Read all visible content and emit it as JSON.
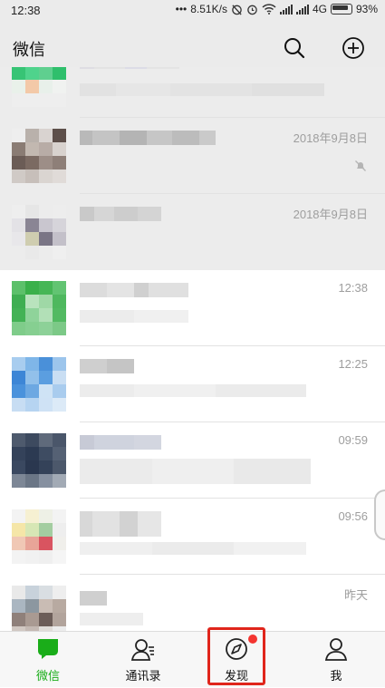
{
  "statusbar": {
    "time": "12:38",
    "dots": "•••",
    "net_speed": "8.51K/s",
    "network_type": "4G",
    "battery": "93%",
    "icons": [
      "alarm-off-icon",
      "alarm-icon",
      "wifi-icon",
      "signal-icon",
      "battery-icon"
    ]
  },
  "header": {
    "title": "微信",
    "search_icon": "search-icon",
    "add_icon": "plus-circle-icon"
  },
  "chats": [
    {
      "time": "",
      "pinned": true,
      "muted": false,
      "avatar_colors": [
        "#e9f2ec",
        "#dfeee4",
        "#e8f3ec",
        "#eef5f0",
        "#37c475",
        "#4fd38c",
        "#5fcf8f",
        "#2fbf6c",
        "#e9f1ea",
        "#f3c9a8",
        "#e8f0ea",
        "#f0f2f0",
        "#eeeeee",
        "#eeeeee",
        "#eeeeee",
        "#eeeeee"
      ]
    },
    {
      "time": "2018年9月8日",
      "pinned": true,
      "muted": true,
      "avatar_colors": [
        "#eeeeee",
        "#b9b1ab",
        "#d9d3d0",
        "#5d4f4a",
        "#8a7c74",
        "#c2b8b0",
        "#b8aca6",
        "#d8d2ce",
        "#6b5c56",
        "#7b6a62",
        "#9d8e87",
        "#8e7f78",
        "#d0cac6",
        "#c7bfba",
        "#dad5d1",
        "#e0dbd8"
      ]
    },
    {
      "time": "2018年9月8日",
      "pinned": true,
      "muted": false,
      "avatar_colors": [
        "#eeeeee",
        "#e6e6e6",
        "#ececec",
        "#ededed",
        "#e3e2e6",
        "#8a8594",
        "#c9c6cf",
        "#d6d4da",
        "#e8e7ea",
        "#cfcdb0",
        "#7a7585",
        "#c3c0c9",
        "#ececec",
        "#e9e9e9",
        "#ececec",
        "#efefef"
      ]
    },
    {
      "time": "12:38",
      "pinned": false,
      "muted": false,
      "avatar_colors": [
        "#5cc06a",
        "#3ab04a",
        "#46b656",
        "#62c472",
        "#3fae52",
        "#b9e3bd",
        "#9fd8a6",
        "#4eb85e",
        "#43b255",
        "#8fd39a",
        "#b2e0b7",
        "#52ba62",
        "#7fcc8a",
        "#86cf91",
        "#8dd198",
        "#7cc987"
      ]
    },
    {
      "time": "12:25",
      "pinned": false,
      "muted": false,
      "avatar_colors": [
        "#a8cdef",
        "#7fb6e8",
        "#4a90d9",
        "#9cc5ec",
        "#3d86d6",
        "#92c0ea",
        "#5b9ee0",
        "#c9def3",
        "#4a92dc",
        "#6da8e2",
        "#cfe3f5",
        "#a9ccee",
        "#c7ddf3",
        "#b6d4f1",
        "#cfe2f5",
        "#dceaf7"
      ]
    },
    {
      "time": "09:59",
      "pinned": false,
      "muted": false,
      "avatar_colors": [
        "#4e5a6d",
        "#3d4a5f",
        "#5f6a7b",
        "#4a566a",
        "#34425a",
        "#2c3a52",
        "#3e4c62",
        "#556174",
        "#3a4860",
        "#2a374f",
        "#344259",
        "#4c586b",
        "#7d8796",
        "#6b7686",
        "#8690a0",
        "#a2aab5"
      ]
    },
    {
      "time": "09:56",
      "pinned": false,
      "muted": false,
      "avatar_colors": [
        "#f3f3f3",
        "#f6f0d2",
        "#eef0e6",
        "#f3f3f3",
        "#f5e6a8",
        "#d7e7b5",
        "#a3cda0",
        "#eeeeee",
        "#f0c8b5",
        "#e8a598",
        "#d95460",
        "#f0efeb",
        "#f3f3f3",
        "#f1f1f1",
        "#efefef",
        "#f5f5f5"
      ]
    },
    {
      "time": "昨天",
      "pinned": false,
      "muted": false,
      "avatar_colors": [
        "#e9e9e9",
        "#c8d2db",
        "#d9dee2",
        "#eeeeee",
        "#aab6c1",
        "#8c97a0",
        "#c9bcb4",
        "#b8aaa1",
        "#8f807a",
        "#a99a92",
        "#6c5d58",
        "#b2a49c",
        "#d1c8c2",
        "#c4b9b3",
        "#e0dcd8",
        "#ececec"
      ]
    }
  ],
  "tabbar": {
    "tabs": [
      {
        "label": "微信",
        "icon": "chat-bubble-icon",
        "active": true
      },
      {
        "label": "通讯录",
        "icon": "contacts-icon",
        "active": false
      },
      {
        "label": "发现",
        "icon": "compass-icon",
        "active": false
      },
      {
        "label": "我",
        "icon": "person-icon",
        "active": false
      }
    ]
  },
  "colors": {
    "accent_green": "#1aad19",
    "highlight_red": "#e0251b",
    "badge_red": "#f43530"
  }
}
